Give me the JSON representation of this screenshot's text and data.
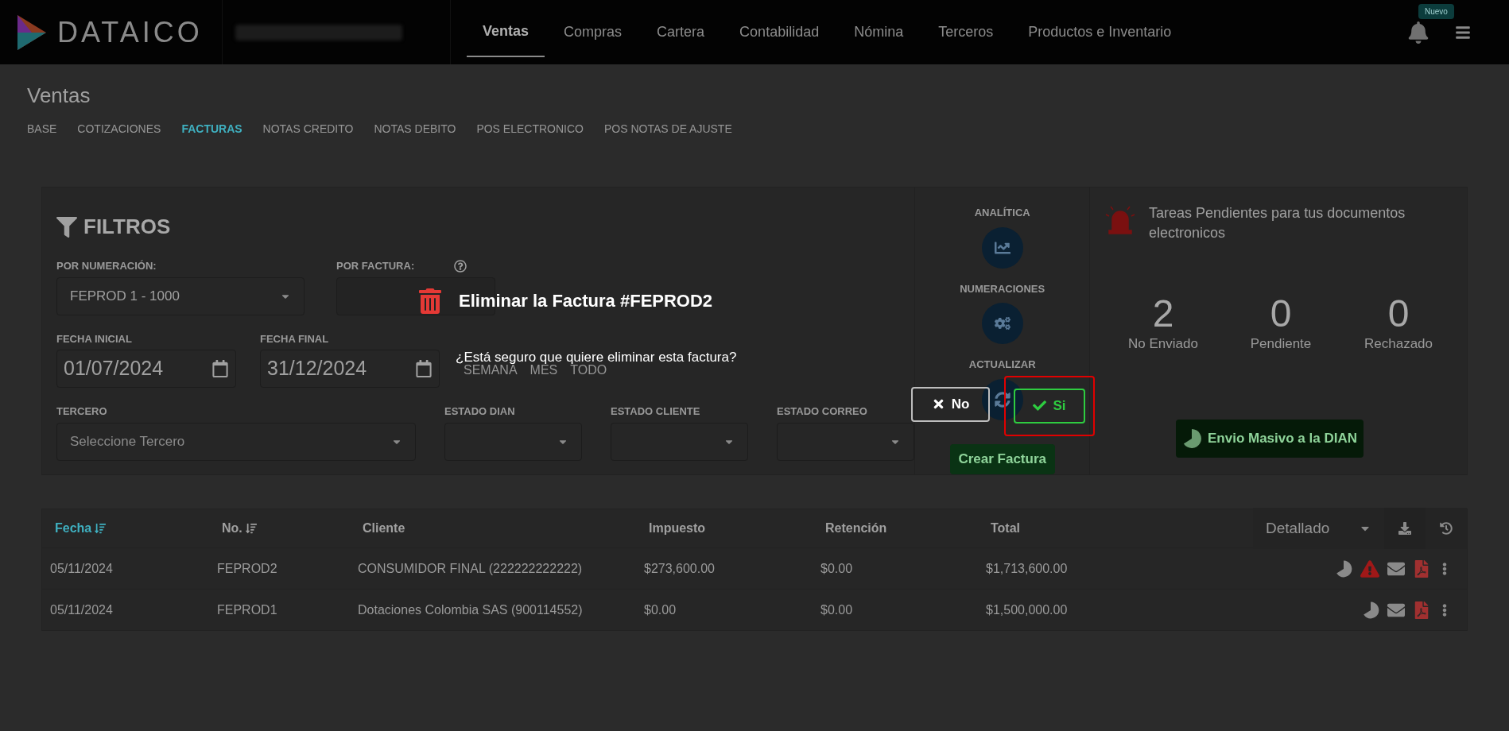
{
  "topbar": {
    "logo": "DATAICO",
    "badge": "Nuevo",
    "nav": [
      {
        "label": "Ventas",
        "selected": true
      },
      {
        "label": "Compras",
        "selected": false
      },
      {
        "label": "Cartera",
        "selected": false
      },
      {
        "label": "Contabilidad",
        "selected": false
      },
      {
        "label": "Nómina",
        "selected": false
      },
      {
        "label": "Terceros",
        "selected": false
      },
      {
        "label": "Productos e Inventario",
        "selected": false
      }
    ]
  },
  "page": {
    "title": "Ventas",
    "tabs": [
      {
        "label": "BASE",
        "selected": false
      },
      {
        "label": "COTIZACIONES",
        "selected": false
      },
      {
        "label": "FACTURAS",
        "selected": true
      },
      {
        "label": "NOTAS CREDITO",
        "selected": false
      },
      {
        "label": "NOTAS DEBITO",
        "selected": false
      },
      {
        "label": "POS ELECTRONICO",
        "selected": false
      },
      {
        "label": "POS NOTAS DE AJUSTE",
        "selected": false
      }
    ]
  },
  "filters": {
    "title": "FILTROS",
    "numeracion": {
      "label": "POR NUMERACIÓN:",
      "value": "FEPROD 1 - 1000"
    },
    "factura": {
      "label": "POR FACTURA:"
    },
    "dates": [
      {
        "label": "FECHA INICIAL",
        "value": "01/07/2024"
      },
      {
        "label": "FECHA FINAL",
        "value": "31/12/2024"
      }
    ],
    "ranges": [
      "SEMANA",
      "MES",
      "TODO"
    ],
    "selects": [
      {
        "label": "TERCERO",
        "placeholder": "Seleccione Tercero"
      },
      {
        "label": "ESTADO DIAN"
      },
      {
        "label": "ESTADO CLIENTE"
      },
      {
        "label": "ESTADO CORREO"
      }
    ]
  },
  "actions": [
    {
      "label": "ANALÍTICA",
      "kind": "chart"
    },
    {
      "label": "NUMERACIONES",
      "kind": "gears"
    },
    {
      "label": "ACTUALIZAR",
      "kind": "refresh"
    }
  ],
  "create_button": "Crear Factura",
  "tasks": {
    "title": "Tareas Pendientes para tus documentos electronicos",
    "counts": [
      {
        "value": "2",
        "label": "No Enviado"
      },
      {
        "value": "0",
        "label": "Pendiente"
      },
      {
        "value": "0",
        "label": "Rechazado"
      }
    ],
    "button": "Envio Masivo a la DIAN"
  },
  "table": {
    "columns": [
      {
        "label": "Fecha",
        "sortable": true,
        "selected": true
      },
      {
        "label": "No.",
        "sortable": true,
        "selected": false
      },
      {
        "label": "Cliente",
        "sortable": false,
        "selected": false
      },
      {
        "label": "Impuesto",
        "sortable": false,
        "selected": false
      },
      {
        "label": "Retención",
        "sortable": false,
        "selected": false
      },
      {
        "label": "Total",
        "sortable": false,
        "selected": false
      }
    ],
    "view": "Detallado",
    "rows": [
      {
        "cells": [
          "05/11/2024",
          "FEPROD2",
          "CONSUMIDOR FINAL (222222222222)",
          "$273,600.00",
          "$0.00",
          "$1,713,600.00"
        ],
        "warning": true
      },
      {
        "cells": [
          "05/11/2024",
          "FEPROD1",
          "Dotaciones Colombia SAS (900114552)",
          "$0.00",
          "$0.00",
          "$1,500,000.00"
        ],
        "warning": false
      }
    ]
  },
  "dialog": {
    "title": "Eliminar la Factura #FEPROD2",
    "message": "¿Está seguro que quiere eliminar esta factura?",
    "buttons": [
      {
        "label": "No",
        "kind": "cancel",
        "highlighted": false
      },
      {
        "label": "Si",
        "kind": "confirm",
        "highlighted": true
      }
    ]
  }
}
